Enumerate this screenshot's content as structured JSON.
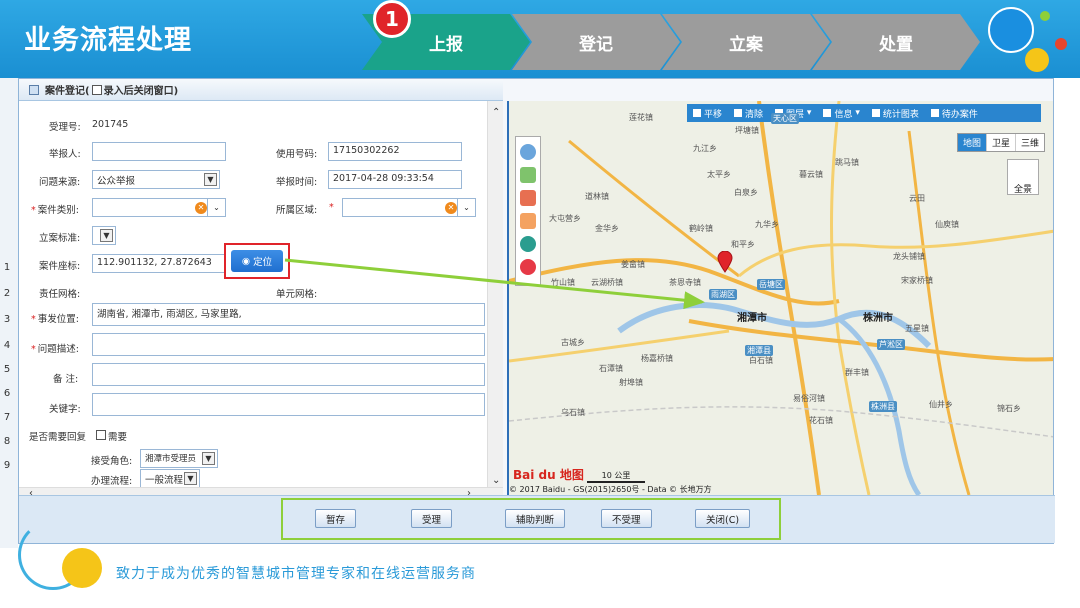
{
  "banner": {
    "title": "业务流程处理",
    "step_badge": "1",
    "steps": [
      "上报",
      "登记",
      "立案",
      "处置"
    ]
  },
  "background_rows": [
    "1",
    "2",
    "3",
    "4",
    "5",
    "6",
    "7",
    "8",
    "9"
  ],
  "dialog": {
    "title": "案件登记(",
    "title_checkbox_label": "录入后关闭窗口)",
    "form": {
      "accept_no_label": "受理号:",
      "accept_no_value": "201745",
      "reporter_label": "举报人:",
      "reporter_value": "",
      "phone_label": "使用号码:",
      "phone_value": "17150302262",
      "source_label": "问题来源:",
      "source_value": "公众举报",
      "report_time_label": "举报时间:",
      "report_time_value": "2017-04-28 09:33:54",
      "category_label": "案件类别:",
      "category_value": "",
      "region_label": "所属区域:",
      "region_value": "",
      "standard_label": "立案标准:",
      "coord_label": "案件座标:",
      "coord_value": "112.901132, 27.872643",
      "locate_button": "定位",
      "grid_label": "责任网格:",
      "unit_grid_label": "单元网格:",
      "location_label": "事发位置:",
      "location_value": "湖南省, 湘潭市, 雨湖区, 马家里路,",
      "desc_label": "问题描述:",
      "remark_label": "备 注:",
      "keyword_label": "关键字:",
      "reply_label": "是否需要回复",
      "reply_option": "需要",
      "role_label": "接受角色:",
      "role_value": "湘潭市受理员",
      "flow_label": "办理流程:",
      "flow_value": "一般流程"
    },
    "map": {
      "toolbar": [
        "平移",
        "清除",
        "图层",
        "信息",
        "统计图表",
        "待办案件"
      ],
      "map_types": [
        "地图",
        "卫星",
        "三维"
      ],
      "fullview": "全景",
      "labels": [
        "莲花镇",
        "天心区",
        "坪塘镇",
        "九江乡",
        "跳马镇",
        "太平乡",
        "暮云镇",
        "白泉乡",
        "道林镇",
        "云田",
        "大屯营乡",
        "金华乡",
        "鹤岭镇",
        "九华乡",
        "仙庾镇",
        "和平乡",
        "姜畲镇",
        "龙头铺镇",
        "竹山镇",
        "云湖桥镇",
        "茶恩寺镇",
        "宋家桥镇",
        "古城乡",
        "杨嘉桥镇",
        "雨湖区",
        "岳塘区",
        "湘潭市",
        "株洲市",
        "湘潭县",
        "芦淞区",
        "五星镇",
        "石潭镇",
        "白石镇",
        "群丰镇",
        "射埠镇",
        "花石镇",
        "株洲县",
        "仙井乡",
        "易俗河镇",
        "乌石镇",
        "锦石乡"
      ],
      "brand": "Bai du 地图",
      "scale": "10 公里",
      "copyright": "© 2017 Baidu - GS(2015)2650号 - Data © 长地万方"
    },
    "actions": [
      "暂存",
      "受理",
      "辅助判断",
      "不受理",
      "关闭(C)"
    ]
  },
  "footer": {
    "slogan": "致力于成为优秀的智慧城市管理专家和在线运营服务商"
  },
  "colors": {
    "banner_blue": "#1a8fd2",
    "step_active": "#1aa38a",
    "step_inactive": "#9c9c9c",
    "highlight_red": "#e0242a",
    "highlight_green": "#8ecf3a",
    "map_marker": "#e0242a"
  }
}
